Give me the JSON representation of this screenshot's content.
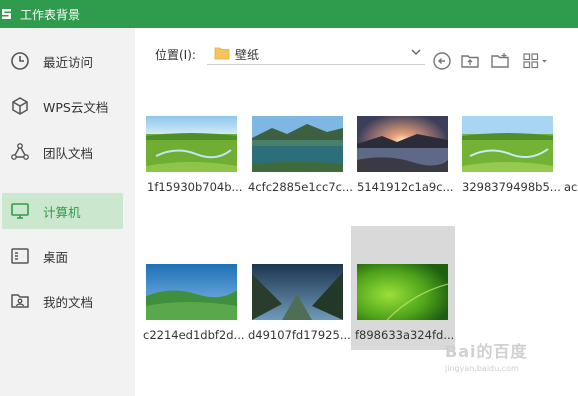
{
  "window": {
    "title": "工作表背景"
  },
  "sidebar": {
    "items": [
      {
        "label": "最近访问",
        "icon": "clock-icon"
      },
      {
        "label": "WPS云文档",
        "icon": "cube-icon"
      },
      {
        "label": "团队文档",
        "icon": "team-icon"
      },
      {
        "label": "计算机",
        "icon": "monitor-icon",
        "active": true
      },
      {
        "label": "桌面",
        "icon": "desktop-icon"
      },
      {
        "label": "我的文档",
        "icon": "user-folder-icon"
      }
    ]
  },
  "toolbar": {
    "location_label": "位置(I):",
    "location_value": "壁纸",
    "buttons": [
      "back-icon",
      "parent-folder-icon",
      "new-folder-icon",
      "view-grid-icon"
    ]
  },
  "files": [
    {
      "name": "1f15930b704b..."
    },
    {
      "name": "4cfc2885e1cc7c..."
    },
    {
      "name": "5141912c1a9c..."
    },
    {
      "name": "3298379498b5..."
    },
    {
      "name": "ac"
    },
    {
      "name": "c2214ed1dbf2d..."
    },
    {
      "name": "d49107fd17925..."
    },
    {
      "name": "f898633a324fd..."
    }
  ],
  "watermark": {
    "text": "Bai的百度",
    "sub": "jingyan.baidu.com"
  },
  "colors": {
    "accent": "#2f9b4c",
    "active_bg": "#cbe8cf",
    "sidebar_bg": "#f2f2f2"
  }
}
